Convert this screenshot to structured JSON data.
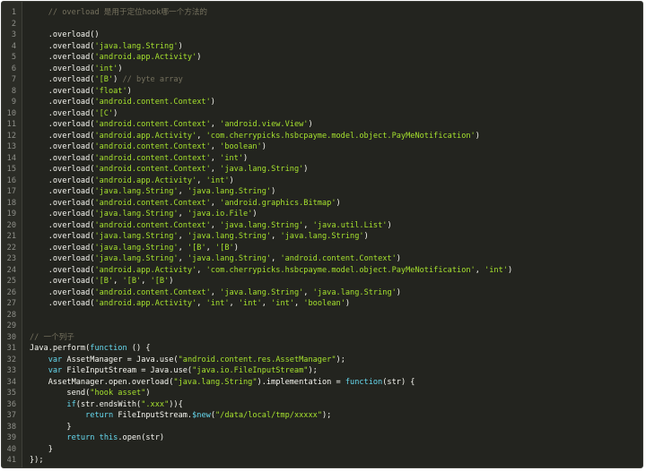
{
  "colors": {
    "background": "#23241f",
    "line_number": "#8f908a",
    "plain": "#f8f8f2",
    "string": "#a6e22e",
    "comment": "#75715e",
    "keyword": "#66d9ef"
  },
  "lines": [
    {
      "n": "1",
      "tokens": [
        {
          "t": "    "
        },
        {
          "t": "// overload 是用于定位hook哪一个方法的",
          "c": "cmt"
        }
      ]
    },
    {
      "n": "2",
      "tokens": []
    },
    {
      "n": "3",
      "tokens": [
        {
          "t": "    .overload()"
        }
      ]
    },
    {
      "n": "4",
      "tokens": [
        {
          "t": "    .overload("
        },
        {
          "t": "'java.lang.String'",
          "c": "str"
        },
        {
          "t": ")"
        }
      ]
    },
    {
      "n": "5",
      "tokens": [
        {
          "t": "    .overload("
        },
        {
          "t": "'android.app.Activity'",
          "c": "str"
        },
        {
          "t": ")"
        }
      ]
    },
    {
      "n": "6",
      "tokens": [
        {
          "t": "    .overload("
        },
        {
          "t": "'int'",
          "c": "str"
        },
        {
          "t": ")"
        }
      ]
    },
    {
      "n": "7",
      "tokens": [
        {
          "t": "    .overload("
        },
        {
          "t": "'[B'",
          "c": "str"
        },
        {
          "t": ") "
        },
        {
          "t": "// byte array",
          "c": "cmt"
        }
      ]
    },
    {
      "n": "8",
      "tokens": [
        {
          "t": "    .overload("
        },
        {
          "t": "'float'",
          "c": "str"
        },
        {
          "t": ")"
        }
      ]
    },
    {
      "n": "9",
      "tokens": [
        {
          "t": "    .overload("
        },
        {
          "t": "'android.content.Context'",
          "c": "str"
        },
        {
          "t": ")"
        }
      ]
    },
    {
      "n": "10",
      "tokens": [
        {
          "t": "    .overload("
        },
        {
          "t": "'[C'",
          "c": "str"
        },
        {
          "t": ")"
        }
      ]
    },
    {
      "n": "11",
      "tokens": [
        {
          "t": "    .overload("
        },
        {
          "t": "'android.content.Context'",
          "c": "str"
        },
        {
          "t": ", "
        },
        {
          "t": "'android.view.View'",
          "c": "str"
        },
        {
          "t": ")"
        }
      ]
    },
    {
      "n": "12",
      "tokens": [
        {
          "t": "    .overload("
        },
        {
          "t": "'android.app.Activity'",
          "c": "str"
        },
        {
          "t": ", "
        },
        {
          "t": "'com.cherrypicks.hsbcpayme.model.object.PayMeNotification'",
          "c": "str"
        },
        {
          "t": ")"
        }
      ]
    },
    {
      "n": "13",
      "tokens": [
        {
          "t": "    .overload("
        },
        {
          "t": "'android.content.Context'",
          "c": "str"
        },
        {
          "t": ", "
        },
        {
          "t": "'boolean'",
          "c": "str"
        },
        {
          "t": ")"
        }
      ]
    },
    {
      "n": "14",
      "tokens": [
        {
          "t": "    .overload("
        },
        {
          "t": "'android.content.Context'",
          "c": "str"
        },
        {
          "t": ", "
        },
        {
          "t": "'int'",
          "c": "str"
        },
        {
          "t": ")"
        }
      ]
    },
    {
      "n": "15",
      "tokens": [
        {
          "t": "    .overload("
        },
        {
          "t": "'android.content.Context'",
          "c": "str"
        },
        {
          "t": ", "
        },
        {
          "t": "'java.lang.String'",
          "c": "str"
        },
        {
          "t": ")"
        }
      ]
    },
    {
      "n": "16",
      "tokens": [
        {
          "t": "    .overload("
        },
        {
          "t": "'android.app.Activity'",
          "c": "str"
        },
        {
          "t": ", "
        },
        {
          "t": "'int'",
          "c": "str"
        },
        {
          "t": ")"
        }
      ]
    },
    {
      "n": "17",
      "tokens": [
        {
          "t": "    .overload("
        },
        {
          "t": "'java.lang.String'",
          "c": "str"
        },
        {
          "t": ", "
        },
        {
          "t": "'java.lang.String'",
          "c": "str"
        },
        {
          "t": ")"
        }
      ]
    },
    {
      "n": "18",
      "tokens": [
        {
          "t": "    .overload("
        },
        {
          "t": "'android.content.Context'",
          "c": "str"
        },
        {
          "t": ", "
        },
        {
          "t": "'android.graphics.Bitmap'",
          "c": "str"
        },
        {
          "t": ")"
        }
      ]
    },
    {
      "n": "19",
      "tokens": [
        {
          "t": "    .overload("
        },
        {
          "t": "'java.lang.String'",
          "c": "str"
        },
        {
          "t": ", "
        },
        {
          "t": "'java.io.File'",
          "c": "str"
        },
        {
          "t": ")"
        }
      ]
    },
    {
      "n": "20",
      "tokens": [
        {
          "t": "    .overload("
        },
        {
          "t": "'android.content.Context'",
          "c": "str"
        },
        {
          "t": ", "
        },
        {
          "t": "'java.lang.String'",
          "c": "str"
        },
        {
          "t": ", "
        },
        {
          "t": "'java.util.List'",
          "c": "str"
        },
        {
          "t": ")"
        }
      ]
    },
    {
      "n": "21",
      "tokens": [
        {
          "t": "    .overload("
        },
        {
          "t": "'java.lang.String'",
          "c": "str"
        },
        {
          "t": ", "
        },
        {
          "t": "'java.lang.String'",
          "c": "str"
        },
        {
          "t": ", "
        },
        {
          "t": "'java.lang.String'",
          "c": "str"
        },
        {
          "t": ")"
        }
      ]
    },
    {
      "n": "22",
      "tokens": [
        {
          "t": "    .overload("
        },
        {
          "t": "'java.lang.String'",
          "c": "str"
        },
        {
          "t": ", "
        },
        {
          "t": "'[B'",
          "c": "str"
        },
        {
          "t": ", "
        },
        {
          "t": "'[B'",
          "c": "str"
        },
        {
          "t": ")"
        }
      ]
    },
    {
      "n": "23",
      "tokens": [
        {
          "t": "    .overload("
        },
        {
          "t": "'java.lang.String'",
          "c": "str"
        },
        {
          "t": ", "
        },
        {
          "t": "'java.lang.String'",
          "c": "str"
        },
        {
          "t": ", "
        },
        {
          "t": "'android.content.Context'",
          "c": "str"
        },
        {
          "t": ")"
        }
      ]
    },
    {
      "n": "24",
      "tokens": [
        {
          "t": "    .overload("
        },
        {
          "t": "'android.app.Activity'",
          "c": "str"
        },
        {
          "t": ", "
        },
        {
          "t": "'com.cherrypicks.hsbcpayme.model.object.PayMeNotification'",
          "c": "str"
        },
        {
          "t": ", "
        },
        {
          "t": "'int'",
          "c": "str"
        },
        {
          "t": ")"
        }
      ]
    },
    {
      "n": "25",
      "tokens": [
        {
          "t": "    .overload("
        },
        {
          "t": "'[B'",
          "c": "str"
        },
        {
          "t": ", "
        },
        {
          "t": "'[B'",
          "c": "str"
        },
        {
          "t": ", "
        },
        {
          "t": "'[B'",
          "c": "str"
        },
        {
          "t": ")"
        }
      ]
    },
    {
      "n": "26",
      "tokens": [
        {
          "t": "    .overload("
        },
        {
          "t": "'android.content.Context'",
          "c": "str"
        },
        {
          "t": ", "
        },
        {
          "t": "'java.lang.String'",
          "c": "str"
        },
        {
          "t": ", "
        },
        {
          "t": "'java.lang.String'",
          "c": "str"
        },
        {
          "t": ")"
        }
      ]
    },
    {
      "n": "27",
      "tokens": [
        {
          "t": "    .overload("
        },
        {
          "t": "'android.app.Activity'",
          "c": "str"
        },
        {
          "t": ", "
        },
        {
          "t": "'int'",
          "c": "str"
        },
        {
          "t": ", "
        },
        {
          "t": "'int'",
          "c": "str"
        },
        {
          "t": ", "
        },
        {
          "t": "'int'",
          "c": "str"
        },
        {
          "t": ", "
        },
        {
          "t": "'boolean'",
          "c": "str"
        },
        {
          "t": ")"
        }
      ]
    },
    {
      "n": "28",
      "tokens": []
    },
    {
      "n": "29",
      "tokens": []
    },
    {
      "n": "30",
      "tokens": [
        {
          "t": "// 一个列子",
          "c": "cmt"
        }
      ]
    },
    {
      "n": "31",
      "tokens": [
        {
          "t": "Java.perform("
        },
        {
          "t": "function",
          "c": "kw"
        },
        {
          "t": " () {"
        }
      ]
    },
    {
      "n": "32",
      "tokens": [
        {
          "t": "    "
        },
        {
          "t": "var",
          "c": "kw"
        },
        {
          "t": " AssetManager = Java.use("
        },
        {
          "t": "\"android.content.res.AssetManager\"",
          "c": "str"
        },
        {
          "t": ");"
        }
      ]
    },
    {
      "n": "33",
      "tokens": [
        {
          "t": "    "
        },
        {
          "t": "var",
          "c": "kw"
        },
        {
          "t": " FileInputStream = Java.use("
        },
        {
          "t": "\"java.io.FileInputStream\"",
          "c": "str"
        },
        {
          "t": ");"
        }
      ]
    },
    {
      "n": "34",
      "tokens": [
        {
          "t": "    AssetManager.open.overload("
        },
        {
          "t": "\"java.lang.String\"",
          "c": "str"
        },
        {
          "t": ").implementation = "
        },
        {
          "t": "function",
          "c": "kw"
        },
        {
          "t": "(str) {"
        }
      ]
    },
    {
      "n": "35",
      "tokens": [
        {
          "t": "        send("
        },
        {
          "t": "\"hook asset\"",
          "c": "str"
        },
        {
          "t": ")"
        }
      ]
    },
    {
      "n": "36",
      "tokens": [
        {
          "t": "        "
        },
        {
          "t": "if",
          "c": "kw"
        },
        {
          "t": "(str.endsWith("
        },
        {
          "t": "\".xxx\"",
          "c": "str"
        },
        {
          "t": ")){"
        }
      ]
    },
    {
      "n": "37",
      "tokens": [
        {
          "t": "            "
        },
        {
          "t": "return",
          "c": "kw"
        },
        {
          "t": " FileInputStream."
        },
        {
          "t": "$new",
          "c": "kw"
        },
        {
          "t": "("
        },
        {
          "t": "\"/data/local/tmp/xxxxx\"",
          "c": "str"
        },
        {
          "t": ");"
        }
      ]
    },
    {
      "n": "38",
      "tokens": [
        {
          "t": "        }"
        }
      ]
    },
    {
      "n": "39",
      "tokens": [
        {
          "t": "        "
        },
        {
          "t": "return",
          "c": "kw"
        },
        {
          "t": " "
        },
        {
          "t": "this",
          "c": "kw"
        },
        {
          "t": ".open(str)"
        }
      ]
    },
    {
      "n": "40",
      "tokens": [
        {
          "t": "    }"
        }
      ]
    },
    {
      "n": "41",
      "tokens": [
        {
          "t": "});"
        }
      ]
    }
  ]
}
